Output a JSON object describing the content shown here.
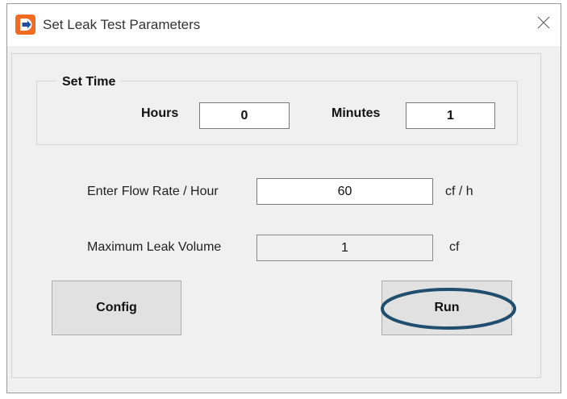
{
  "window": {
    "title": "Set Leak Test Parameters",
    "icon": "app-icon",
    "close_icon": "close-icon"
  },
  "set_time": {
    "group_label": "Set Time",
    "hours_label": "Hours",
    "hours_value": "0",
    "minutes_label": "Minutes",
    "minutes_value": "1"
  },
  "flow_rate": {
    "label": "Enter Flow Rate / Hour",
    "value": "60",
    "unit": "cf / h"
  },
  "leak_volume": {
    "label": "Maximum Leak Volume",
    "value": "1",
    "unit": "cf"
  },
  "buttons": {
    "config": "Config",
    "run": "Run"
  },
  "colors": {
    "highlight": "#1f4e6e",
    "icon_orange": "#f26b21",
    "icon_blue": "#1e4fa0"
  }
}
